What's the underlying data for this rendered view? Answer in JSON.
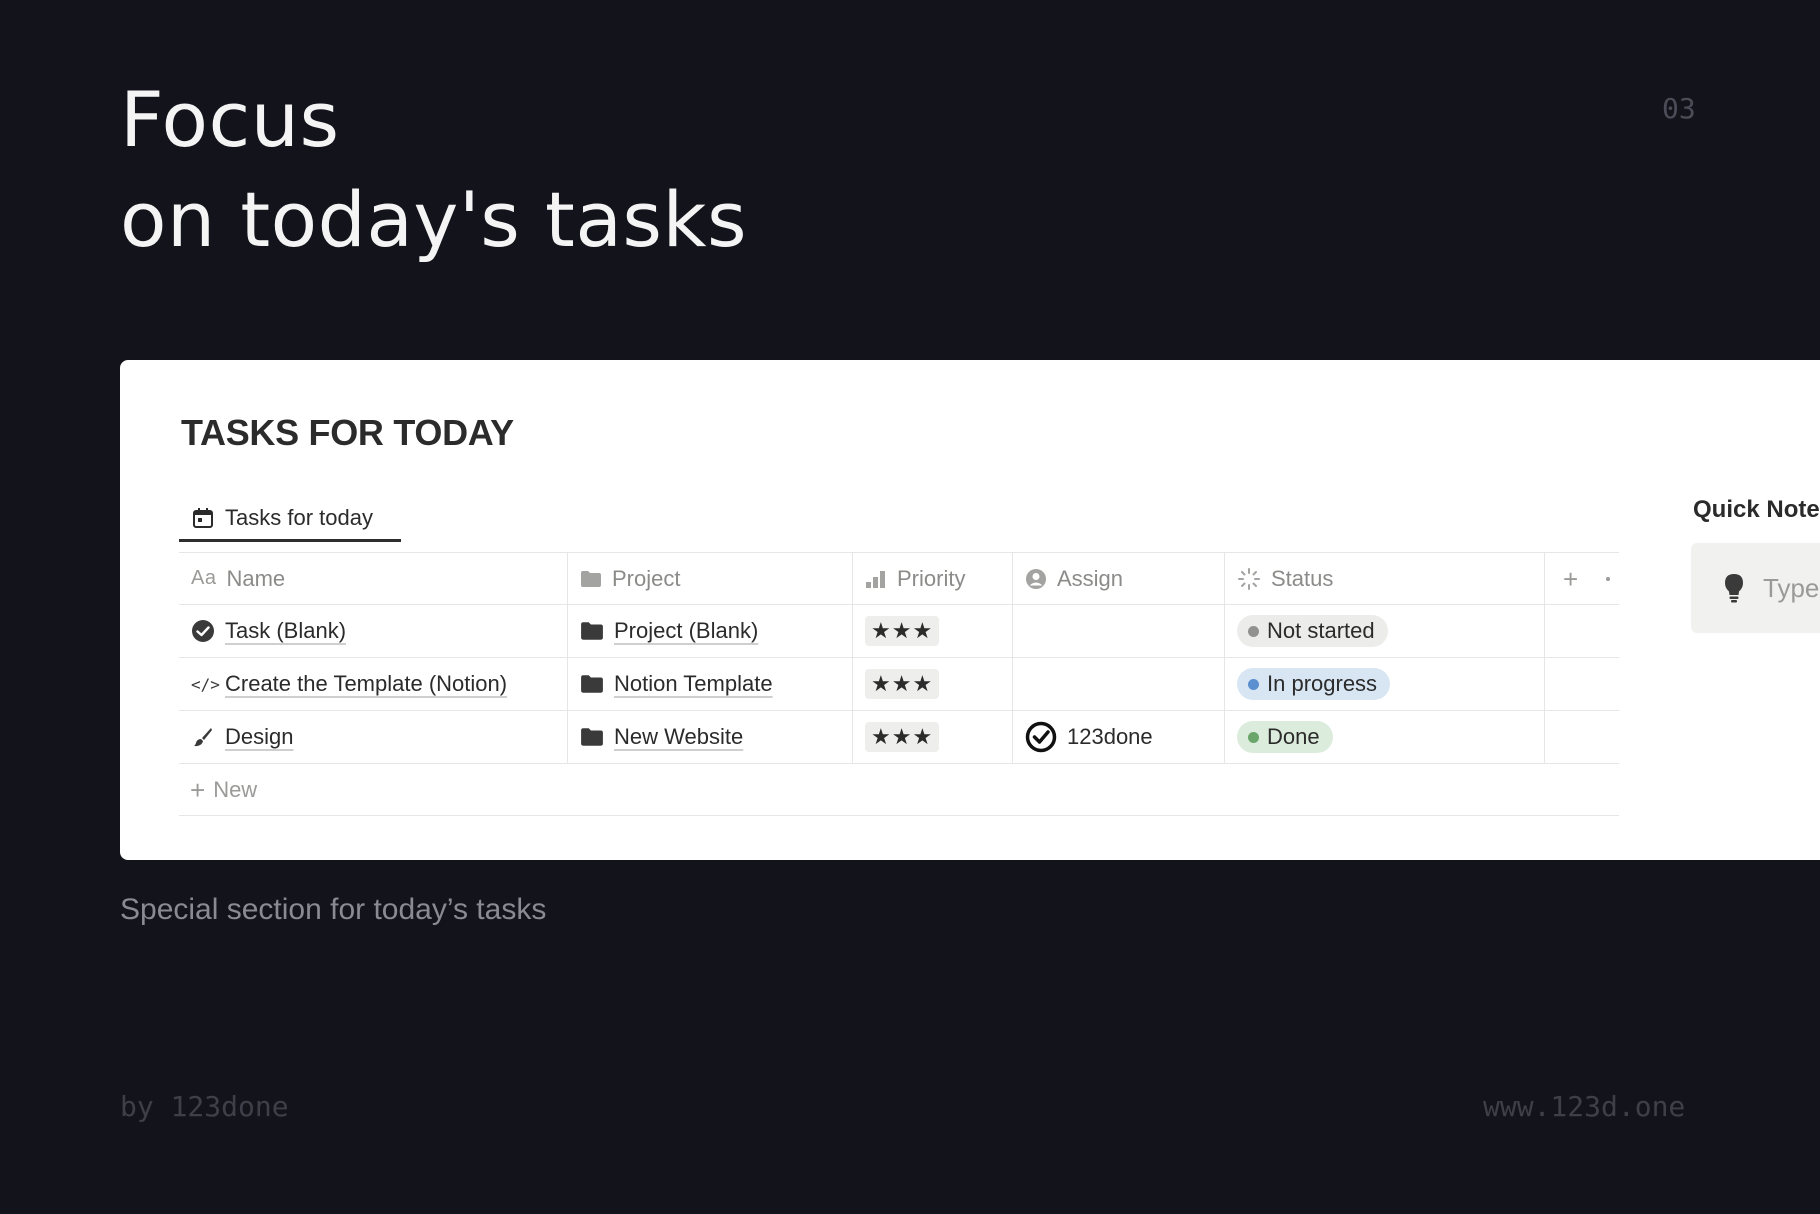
{
  "hero": {
    "title_line1": "Focus",
    "title_line2": "on today's tasks",
    "slide_number": "03"
  },
  "card": {
    "title": "TASKS FOR TODAY",
    "view_tab": {
      "label": "Tasks for today",
      "icon": "calendar-icon"
    },
    "table": {
      "columns": [
        {
          "label": "Name",
          "prefix": "Aa"
        },
        {
          "label": "Project",
          "icon": "folder-icon"
        },
        {
          "label": "Priority",
          "icon": "bars-icon"
        },
        {
          "label": "Assign",
          "icon": "person-icon"
        },
        {
          "label": "Status",
          "icon": "spinner-icon"
        }
      ],
      "rows": [
        {
          "name": "Task (Blank)",
          "name_icon": "check-circle-icon",
          "project": "Project (Blank)",
          "priority": "★★★",
          "assign": "",
          "status": "Not started"
        },
        {
          "name": "Create the Template (Notion)",
          "name_icon": "code-icon",
          "name_icon_text": "</>",
          "project": "Notion Template",
          "priority": "★★★",
          "assign": "",
          "status": "In progress"
        },
        {
          "name": "Design",
          "name_icon": "brush-icon",
          "project": "New Website",
          "priority": "★★★",
          "assign": "123done",
          "status": "Done"
        }
      ],
      "new_label": "New"
    },
    "status_colors": {
      "Not started": {
        "bg": "#ececeb",
        "dot": "#91918f"
      },
      "In progress": {
        "bg": "#d8e6f4",
        "dot": "#5a8fd0"
      },
      "Done": {
        "bg": "#dcecdc",
        "dot": "#6aa66a"
      }
    },
    "side": {
      "title": "Quick Note",
      "placeholder": "Type",
      "icon": "lightbulb-icon"
    }
  },
  "caption": "Special section for today’s tasks",
  "footer": {
    "left": "by 123done",
    "right": "www.123d.one"
  }
}
